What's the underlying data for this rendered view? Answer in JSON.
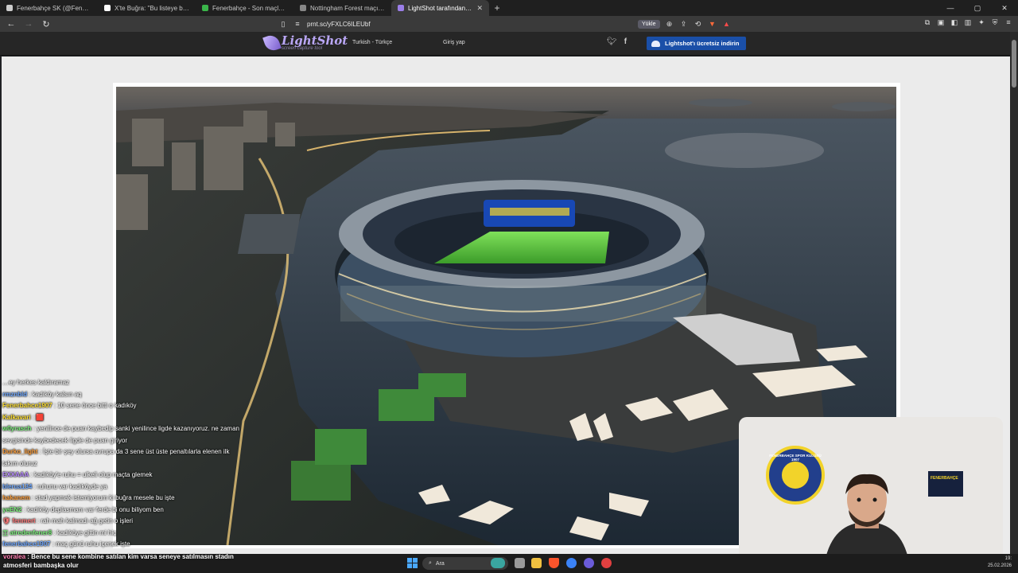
{
  "browser": {
    "tabs": [
      {
        "title": "Fenerbahçe SK (@Fenerbahce) / X",
        "color": "#cccccc",
        "active": false
      },
      {
        "title": "X'te Buğra: \"Bu listeye bir de Skrinia\" / X",
        "color": "#ffffff",
        "active": false
      },
      {
        "title": "Fenerbahçe - Son maçlar, skorlar ve oyun",
        "color": "#3ab54a",
        "active": false
      },
      {
        "title": "Nottingham Forest maçının hazırlıkları",
        "color": "#888888",
        "active": false
      },
      {
        "title": "LightShot tarafından Ekran Görüntüsü",
        "color": "#9b7ee8",
        "active": true
      }
    ],
    "url": "prnt.sc/yFXLC6ILEUbf",
    "yukle_label": "Yükle",
    "extension_badge": "2"
  },
  "site": {
    "logo_name": "LightShot",
    "logo_tagline": "screen capture tool",
    "language": "Turkish - Türkçe",
    "login": "Giriş yap",
    "download_button": "Lightshot'ı ücretsiz indirin"
  },
  "chat": [
    {
      "user": "",
      "text": "…ey herkes kaldıramaz",
      "color": "#c9a24a"
    },
    {
      "user": "rmznbld",
      "text": "kadıköy kalsın aq",
      "color": "#6fa8ff"
    },
    {
      "user": "Fenerbahce1907",
      "text": "10 sene önce bitti o kadıköy",
      "color": "#ffe033"
    },
    {
      "user": "Kalkavari",
      "text": "🟥",
      "color": "#ffe033"
    },
    {
      "user": "w0yrasch",
      "text": "yenilince de puan kaybedip sanki yenilince ligde kazanıyoruz. ne zaman",
      "color": "#7cf07c"
    },
    {
      "user": "",
      "text": "sevgisinde kaybedecek ligde de puan giriyor",
      "color": "#ffffff"
    },
    {
      "user": "Durko_light",
      "text": "İşte bir şey olursa avrupa da 3 sene üst üste penaltılarla elenen ilk",
      "color": "#ff9f3a"
    },
    {
      "user": "",
      "text": "takım oluruz",
      "color": "#ffffff"
    },
    {
      "user": "EXXAAA",
      "text": "kadıköy'e ruhu = ulkeli olup maçta glemek",
      "color": "#b88bff"
    },
    {
      "user": "blerua134",
      "text": "ruhunu var kadıköyde ya",
      "color": "#6fa8ff"
    },
    {
      "user": "hakanem",
      "text": "stad yapmak istemiyorum ki buğra mesele bu işte",
      "color": "#ff9f3a"
    },
    {
      "user": "yeEN2",
      "text": "kadıköy deplasmanı var ferde bi onu biliyom ben",
      "color": "#7cf07c"
    },
    {
      "user": "🛡 fenmert",
      "text": "rah mah kalmadı ağ getin o işleri",
      "color": "#ff7a7a"
    },
    {
      "user": "🇹 atredenfener8",
      "text": "kadıköye gittin mi hiç",
      "color": "#7cf07c"
    },
    {
      "user": "fenerbahce1907",
      "text": "maç günü ruhu içenek işte",
      "color": "#6fa8ff"
    }
  ],
  "ticker": {
    "user": "voralea",
    "line1": "Bence bu sene kombine satılan kim varsa seneye satılmasın stadın",
    "line2": "atmosferi bambaşka olur"
  },
  "webcam": {
    "crest_text": "FENERBAHÇE SPOR KULÜBÜ 1907",
    "card_text": "FENERBAHÇE"
  },
  "taskbar": {
    "search_placeholder": "Ara",
    "date": "25.02.2026",
    "time": "19:"
  }
}
